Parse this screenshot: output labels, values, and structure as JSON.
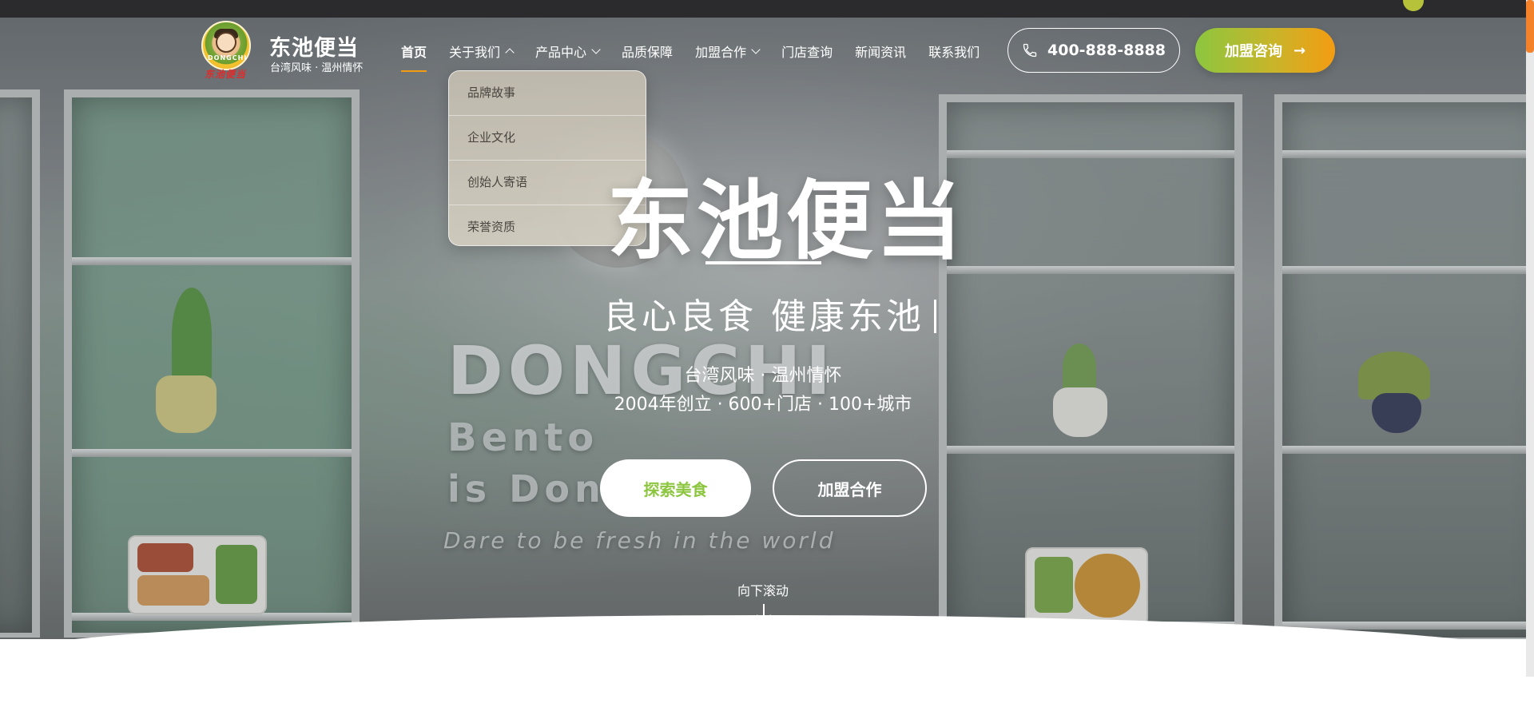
{
  "brand": {
    "name": "东池便当",
    "tagline": "台湾风味 · 温州情怀",
    "logo_text": "DONGCHI",
    "logo_script": "东池便当"
  },
  "nav": {
    "items": [
      {
        "label": "首页",
        "active": true,
        "dropdown": null
      },
      {
        "label": "关于我们",
        "active": false,
        "dropdown": "open"
      },
      {
        "label": "产品中心",
        "active": false,
        "dropdown": "closed"
      },
      {
        "label": "品质保障",
        "active": false,
        "dropdown": null
      },
      {
        "label": "加盟合作",
        "active": false,
        "dropdown": "closed"
      },
      {
        "label": "门店查询",
        "active": false,
        "dropdown": null
      },
      {
        "label": "新闻资讯",
        "active": false,
        "dropdown": null
      },
      {
        "label": "联系我们",
        "active": false,
        "dropdown": null
      }
    ],
    "about_dropdown": [
      "品牌故事",
      "企业文化",
      "创始人寄语",
      "荣誉资质"
    ]
  },
  "header": {
    "phone": "400-888-8888",
    "phone_icon": "phone-icon",
    "join_label": "加盟咨询",
    "join_icon": "arrow-right-icon"
  },
  "hero": {
    "title": "东池便当",
    "slogan": "良心良食 健康东池",
    "subtitle_1": "台湾风味 · 温州情怀",
    "subtitle_2": "2004年创立 · 600+门店 · 100+城市",
    "explore_label": "探索美食",
    "join_label": "加盟合作",
    "scroll_hint": "向下滚动",
    "scroll_icon": "arrow-down-icon",
    "background_signage": {
      "line1": "DONGCHI",
      "line2": "Bento",
      "line3": "is Dongc",
      "line4": "Dare to be fresh in the world"
    }
  },
  "colors": {
    "accent_orange": "#f39c12",
    "accent_green": "#8cc63f",
    "text_light": "#ffffff",
    "dropdown_text": "#4a4540"
  }
}
